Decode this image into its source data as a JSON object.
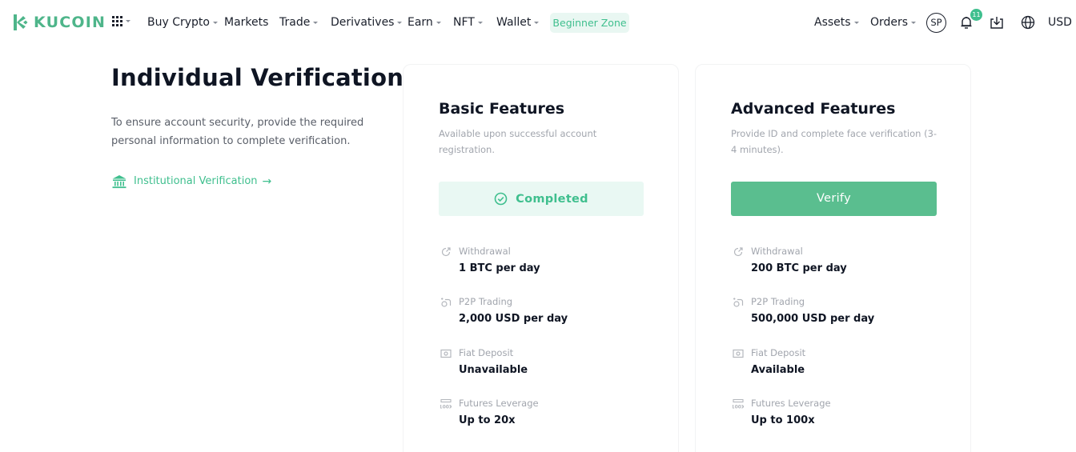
{
  "header": {
    "logo_text": "KUCOIN",
    "nav": [
      {
        "label": "Buy Crypto",
        "dropdown": true
      },
      {
        "label": "Markets",
        "dropdown": false
      },
      {
        "label": "Trade",
        "dropdown": true
      },
      {
        "label": "Derivatives",
        "dropdown": true
      },
      {
        "label": "Earn",
        "dropdown": true
      },
      {
        "label": "NFT",
        "dropdown": true
      },
      {
        "label": "Wallet",
        "dropdown": true
      }
    ],
    "beginner_zone": "Beginner Zone",
    "assets": "Assets",
    "orders": "Orders",
    "avatar_initials": "SP",
    "notification_count": "11",
    "currency": "USD",
    "icons": [
      "apps-grid-icon",
      "bell-icon",
      "download-icon",
      "globe-icon"
    ],
    "accent_color": "#3fbf8e"
  },
  "intro": {
    "title": "Individual Verification",
    "description": "To ensure account security, provide the required personal information to complete verification.",
    "institutional_link": "Institutional Verification",
    "institutional_arrow": "→"
  },
  "cards": {
    "basic": {
      "title": "Basic Features",
      "description": "Available upon successful account registration.",
      "status": "Completed",
      "features": [
        {
          "icon": "withdrawal-icon",
          "label": "Withdrawal",
          "value": "1 BTC per day"
        },
        {
          "icon": "p2p-icon",
          "label": "P2P Trading",
          "value": "2,000 USD per day"
        },
        {
          "icon": "fiat-deposit-icon",
          "label": "Fiat Deposit",
          "value": "Unavailable"
        },
        {
          "icon": "futures-leverage-icon",
          "label": "Futures Leverage",
          "value": "Up to 20x"
        }
      ]
    },
    "advanced": {
      "title": "Advanced Features",
      "description": "Provide ID and complete face verification (3-4 minutes).",
      "button": "Verify",
      "features": [
        {
          "icon": "withdrawal-icon",
          "label": "Withdrawal",
          "value": "200 BTC per day"
        },
        {
          "icon": "p2p-icon",
          "label": "P2P Trading",
          "value": "500,000 USD per day"
        },
        {
          "icon": "fiat-deposit-icon",
          "label": "Fiat Deposit",
          "value": "Available"
        },
        {
          "icon": "futures-leverage-icon",
          "label": "Futures Leverage",
          "value": "Up to 100x"
        }
      ]
    }
  }
}
